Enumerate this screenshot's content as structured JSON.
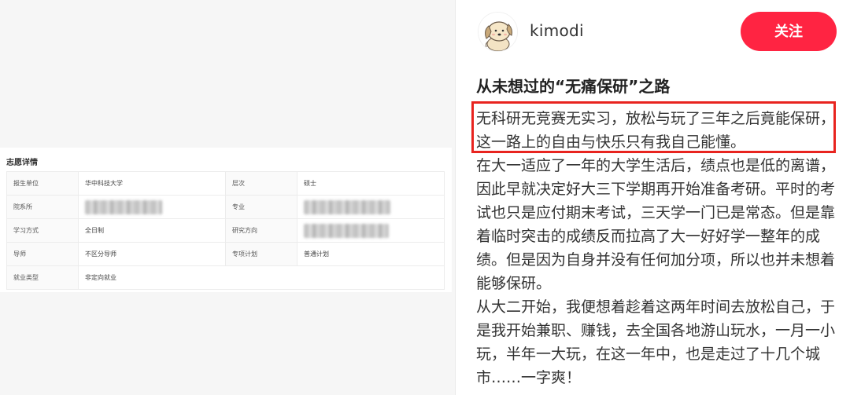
{
  "left_card": {
    "title": "志愿详情",
    "rows": [
      {
        "k1": "报生单位",
        "v1": "华中科技大学",
        "k2": "层次",
        "v2": "硕士"
      },
      {
        "k1": "院系所",
        "v1": "",
        "k2": "专业",
        "v2": ""
      },
      {
        "k1": "学习方式",
        "v1": "全日制",
        "k2": "研究方向",
        "v2": ""
      },
      {
        "k1": "导师",
        "v1": "不区分导师",
        "k2": "专项计划",
        "v2": "普通计划"
      },
      {
        "k1": "就业类型",
        "v1": "非定向就业"
      }
    ]
  },
  "post": {
    "username": "kimodi",
    "follow_label": "关注",
    "title": "从未想过的“无痛保研”之路",
    "paragraphs": [
      "无科研无竞赛无实习，放松与玩了三年之后竟能保研，这一路上的自由与快乐只有我自己能懂。",
      "在大一适应了一年的大学生活后，绩点也是低的离谱，因此早就决定好大三下学期再开始准备考研。平时的考试也只是应付期末考试，三天学一门已是常态。但是靠着临时突击的成绩反而拉高了大一好好学一整年的成绩。但是因为自身并没有任何加分项，所以也并未想着能够保研。",
      "从大二开始，我便想着趁着这两年时间去放松自己，于是我开始兼职、赚钱，去全国各地游山玩水，一月一小玩，半年一大玩，在这一年中，也是走过了十几个城市……一字爽！"
    ]
  },
  "colors": {
    "follow_button": "#ff2442",
    "highlight_box": "#e8241f"
  },
  "icons": {
    "avatar": "cartoon-dog-avatar"
  }
}
